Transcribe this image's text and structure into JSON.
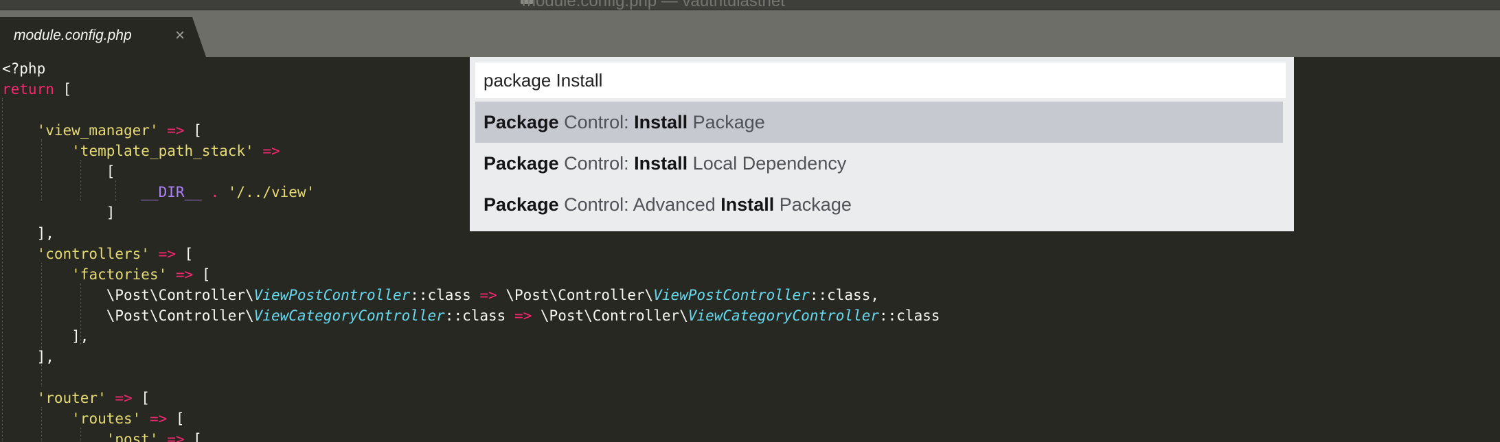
{
  "window": {
    "title": "module.config.php — vauthtulastnet"
  },
  "tab": {
    "label": "module.config.php",
    "close_glyph": "×"
  },
  "palette": {
    "query": "package Install",
    "results": [
      {
        "bold1": "Package",
        "part2": " Control: ",
        "bold3": "Install",
        "part4": " Package",
        "selected": true
      },
      {
        "bold1": "Package",
        "part2": " Control: ",
        "bold3": "Install",
        "part4": " Local Dependency",
        "selected": false
      },
      {
        "bold1": "Package",
        "part2": " Control: Advanced ",
        "bold3": "Install",
        "part4": " Package",
        "selected": false
      }
    ]
  },
  "code": [
    [
      {
        "t": "<?php",
        "c": "plain"
      }
    ],
    [
      {
        "t": "return",
        "c": "kw"
      },
      {
        "t": " [",
        "c": "plain"
      }
    ],
    [],
    [
      {
        "t": "    ",
        "c": "plain"
      },
      {
        "t": "'view_manager'",
        "c": "str"
      },
      {
        "t": " ",
        "c": "plain"
      },
      {
        "t": "=>",
        "c": "op"
      },
      {
        "t": " [",
        "c": "plain"
      }
    ],
    [
      {
        "t": "        ",
        "c": "plain"
      },
      {
        "t": "'template_path_stack'",
        "c": "str"
      },
      {
        "t": " ",
        "c": "plain"
      },
      {
        "t": "=>",
        "c": "op"
      }
    ],
    [
      {
        "t": "            [",
        "c": "plain"
      }
    ],
    [
      {
        "t": "                ",
        "c": "plain"
      },
      {
        "t": "__DIR__",
        "c": "const"
      },
      {
        "t": " ",
        "c": "plain"
      },
      {
        "t": ".",
        "c": "op"
      },
      {
        "t": " ",
        "c": "plain"
      },
      {
        "t": "'/../view'",
        "c": "str"
      }
    ],
    [
      {
        "t": "            ]",
        "c": "plain"
      }
    ],
    [
      {
        "t": "    ],",
        "c": "plain"
      }
    ],
    [
      {
        "t": "    ",
        "c": "plain"
      },
      {
        "t": "'controllers'",
        "c": "str"
      },
      {
        "t": " ",
        "c": "plain"
      },
      {
        "t": "=>",
        "c": "op"
      },
      {
        "t": " [",
        "c": "plain"
      }
    ],
    [
      {
        "t": "        ",
        "c": "plain"
      },
      {
        "t": "'factories'",
        "c": "str"
      },
      {
        "t": " ",
        "c": "plain"
      },
      {
        "t": "=>",
        "c": "op"
      },
      {
        "t": " [",
        "c": "plain"
      }
    ],
    [
      {
        "t": "            \\Post\\Controller\\",
        "c": "plain"
      },
      {
        "t": "ViewPostController",
        "c": "cls"
      },
      {
        "t": "::class ",
        "c": "plain"
      },
      {
        "t": "=>",
        "c": "op"
      },
      {
        "t": " \\Post\\Controller\\",
        "c": "plain"
      },
      {
        "t": "ViewPostController",
        "c": "cls"
      },
      {
        "t": "::class,",
        "c": "plain"
      }
    ],
    [
      {
        "t": "            \\Post\\Controller\\",
        "c": "plain"
      },
      {
        "t": "ViewCategoryController",
        "c": "cls"
      },
      {
        "t": "::class ",
        "c": "plain"
      },
      {
        "t": "=>",
        "c": "op"
      },
      {
        "t": " \\Post\\Controller\\",
        "c": "plain"
      },
      {
        "t": "ViewCategoryController",
        "c": "cls"
      },
      {
        "t": "::class",
        "c": "plain"
      }
    ],
    [
      {
        "t": "        ],",
        "c": "plain"
      }
    ],
    [
      {
        "t": "    ],",
        "c": "plain"
      }
    ],
    [],
    [
      {
        "t": "    ",
        "c": "plain"
      },
      {
        "t": "'router'",
        "c": "str"
      },
      {
        "t": " ",
        "c": "plain"
      },
      {
        "t": "=>",
        "c": "op"
      },
      {
        "t": " [",
        "c": "plain"
      }
    ],
    [
      {
        "t": "        ",
        "c": "plain"
      },
      {
        "t": "'routes'",
        "c": "str"
      },
      {
        "t": " ",
        "c": "plain"
      },
      {
        "t": "=>",
        "c": "op"
      },
      {
        "t": " [",
        "c": "plain"
      }
    ],
    [
      {
        "t": "            ",
        "c": "plain"
      },
      {
        "t": "'post'",
        "c": "str"
      },
      {
        "t": " ",
        "c": "plain"
      },
      {
        "t": "=>",
        "c": "op"
      },
      {
        "t": " [",
        "c": "plain"
      }
    ]
  ]
}
